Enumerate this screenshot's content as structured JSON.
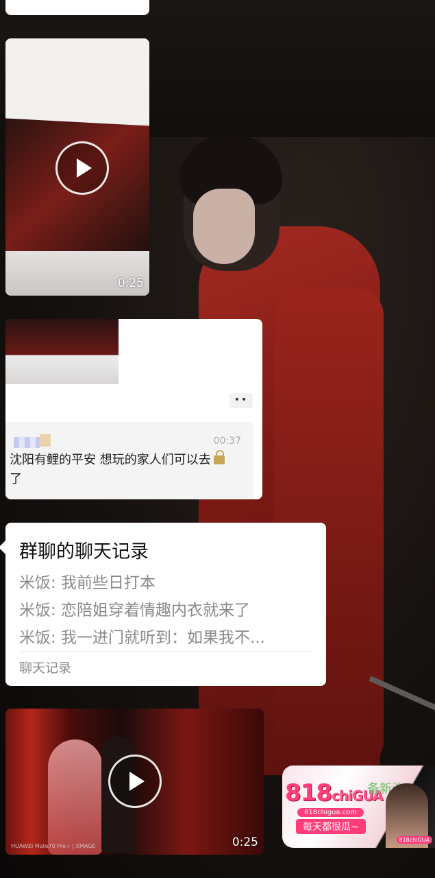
{
  "video1": {
    "duration": "0:25"
  },
  "message": {
    "time": "00:37",
    "text": "沈阳有鲤的平安 想玩的家人们可以去",
    "text_tail": "了",
    "more_label": "••"
  },
  "chat_record": {
    "title": "群聊的聊天记录",
    "lines": [
      "米饭: 我前些日打本",
      "米饭: 恋陪姐穿着情趣内衣就来了",
      "米饭: 我一进门就听到：如果我不..."
    ],
    "footer": "聊天记录"
  },
  "video2": {
    "duration": "0:25",
    "watermark": "HUAWEI Mate70 Pro+ | XMAGE"
  },
  "ad": {
    "logo_num": "818",
    "logo_text": "chiGUA",
    "domain": "818chigua.com",
    "slogan": "每天都很瓜~",
    "side_text": "备新浩",
    "badge": "818chiGUA"
  },
  "colors": {
    "accent": "#ff3d7a",
    "bubble": "#ffffff",
    "muted_text": "#8a8a8a"
  }
}
